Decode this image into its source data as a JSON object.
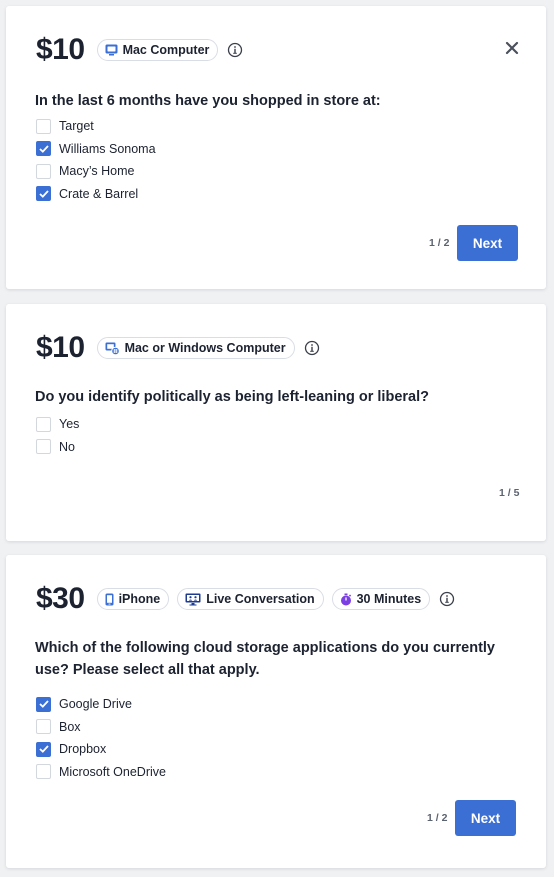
{
  "cards": [
    {
      "price": "$10",
      "tags": [
        {
          "label": "Mac Computer",
          "icon": "mac-computer-icon"
        }
      ],
      "question": "In the last 6 months have you shopped in store at:",
      "options": [
        {
          "label": "Target",
          "checked": false
        },
        {
          "label": "Williams Sonoma",
          "checked": true
        },
        {
          "label": "Macy’s Home",
          "checked": false
        },
        {
          "label": "Crate & Barrel",
          "checked": true
        }
      ],
      "pager": "1 / 2",
      "next_label": "Next"
    },
    {
      "price": "$10",
      "tags": [
        {
          "label": "Mac or Windows Computer",
          "icon": "mac-or-windows-icon"
        }
      ],
      "question": "Do you identify politically as being left-leaning or liberal?",
      "options": [
        {
          "label": "Yes",
          "checked": false
        },
        {
          "label": "No",
          "checked": false
        }
      ],
      "pager": "1 / 5"
    },
    {
      "price": "$30",
      "tags": [
        {
          "label": "iPhone",
          "icon": "iphone-icon"
        },
        {
          "label": "Live Conversation",
          "icon": "live-conversation-icon"
        },
        {
          "label": "30 Minutes",
          "icon": "stopwatch-icon"
        }
      ],
      "question": "Which of the following cloud storage applications do you currently use? Please select all that apply.",
      "options": [
        {
          "label": "Google Drive",
          "checked": true
        },
        {
          "label": "Box",
          "checked": false
        },
        {
          "label": "Dropbox",
          "checked": true
        },
        {
          "label": "Microsoft OneDrive",
          "checked": false
        }
      ],
      "pager": "1 / 2",
      "next_label": "Next"
    }
  ],
  "colors": {
    "accent": "#3b6fd4",
    "stopwatch": "#7b3fe4",
    "page_background": "#f0f1f3"
  }
}
